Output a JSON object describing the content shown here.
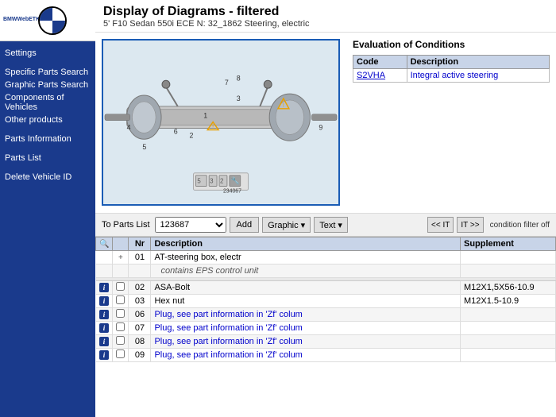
{
  "header": {
    "title": "Display of Diagrams - filtered",
    "subtitle": "5' F10 Sedan 550i ECE N: 32_1862 Steering, electric"
  },
  "sidebar": {
    "logo_text": "BMWWebETK",
    "items": [
      {
        "label": "Settings",
        "id": "settings"
      },
      {
        "label": "Specific Parts Search",
        "id": "specific-parts-search"
      },
      {
        "label": "Graphic Parts Search",
        "id": "graphic-parts-search"
      },
      {
        "label": "Components of Vehicles",
        "id": "components-of-vehicles"
      },
      {
        "label": "Other products",
        "id": "other-products"
      },
      {
        "label": "Parts Information",
        "id": "parts-information"
      },
      {
        "label": "Parts List",
        "id": "parts-list"
      },
      {
        "label": "Delete Vehicle ID",
        "id": "delete-vehicle-id"
      }
    ]
  },
  "evaluation": {
    "title": "Evaluation of Conditions",
    "table": {
      "headers": [
        "Code",
        "Description"
      ],
      "rows": [
        {
          "code": "S2VHA",
          "description": "Integral active steering"
        }
      ]
    }
  },
  "toolbar": {
    "to_parts_list_label": "To Parts List",
    "select_value": "123687",
    "add_button": "Add",
    "graphic_button": "Graphic ▾",
    "text_button": "Text ▾",
    "nav_prev": "<< IT",
    "nav_next": "IT >>",
    "condition_filter": "condition filter off"
  },
  "parts_table": {
    "headers": [
      "",
      "",
      "Nr",
      "Description",
      "Supplement"
    ],
    "rows": [
      {
        "icon": "",
        "plus": "+",
        "nr": "01",
        "desc": "AT-steering box, electr",
        "supp": "",
        "sub": false,
        "has_info": false,
        "has_check": false
      },
      {
        "icon": "",
        "plus": "",
        "nr": "",
        "desc": "contains EPS control unit",
        "supp": "",
        "sub": true,
        "has_info": false,
        "has_check": false
      },
      {
        "icon": "i",
        "plus": "",
        "nr": "02",
        "desc": "ASA-Bolt",
        "supp": "M12X1,5X56-10.9",
        "sub": false,
        "has_info": true,
        "has_check": true
      },
      {
        "icon": "i",
        "plus": "",
        "nr": "03",
        "desc": "Hex nut",
        "supp": "M12X1.5-10.9",
        "sub": false,
        "has_info": true,
        "has_check": true
      },
      {
        "icon": "i",
        "plus": "",
        "nr": "06",
        "desc": "Plug, see part information in 'Zf' colum",
        "supp": "",
        "sub": false,
        "has_info": true,
        "has_check": true,
        "link": true
      },
      {
        "icon": "i",
        "plus": "",
        "nr": "07",
        "desc": "Plug, see part information in 'Zf' colum",
        "supp": "",
        "sub": false,
        "has_info": true,
        "has_check": true,
        "link": true
      },
      {
        "icon": "i",
        "plus": "",
        "nr": "08",
        "desc": "Plug, see part information in 'Zf' colum",
        "supp": "",
        "sub": false,
        "has_info": true,
        "has_check": true,
        "link": true
      },
      {
        "icon": "i",
        "plus": "",
        "nr": "09",
        "desc": "Plug, see part information in 'Zf' colum",
        "supp": "",
        "sub": false,
        "has_info": true,
        "has_check": true,
        "link": true
      }
    ]
  }
}
